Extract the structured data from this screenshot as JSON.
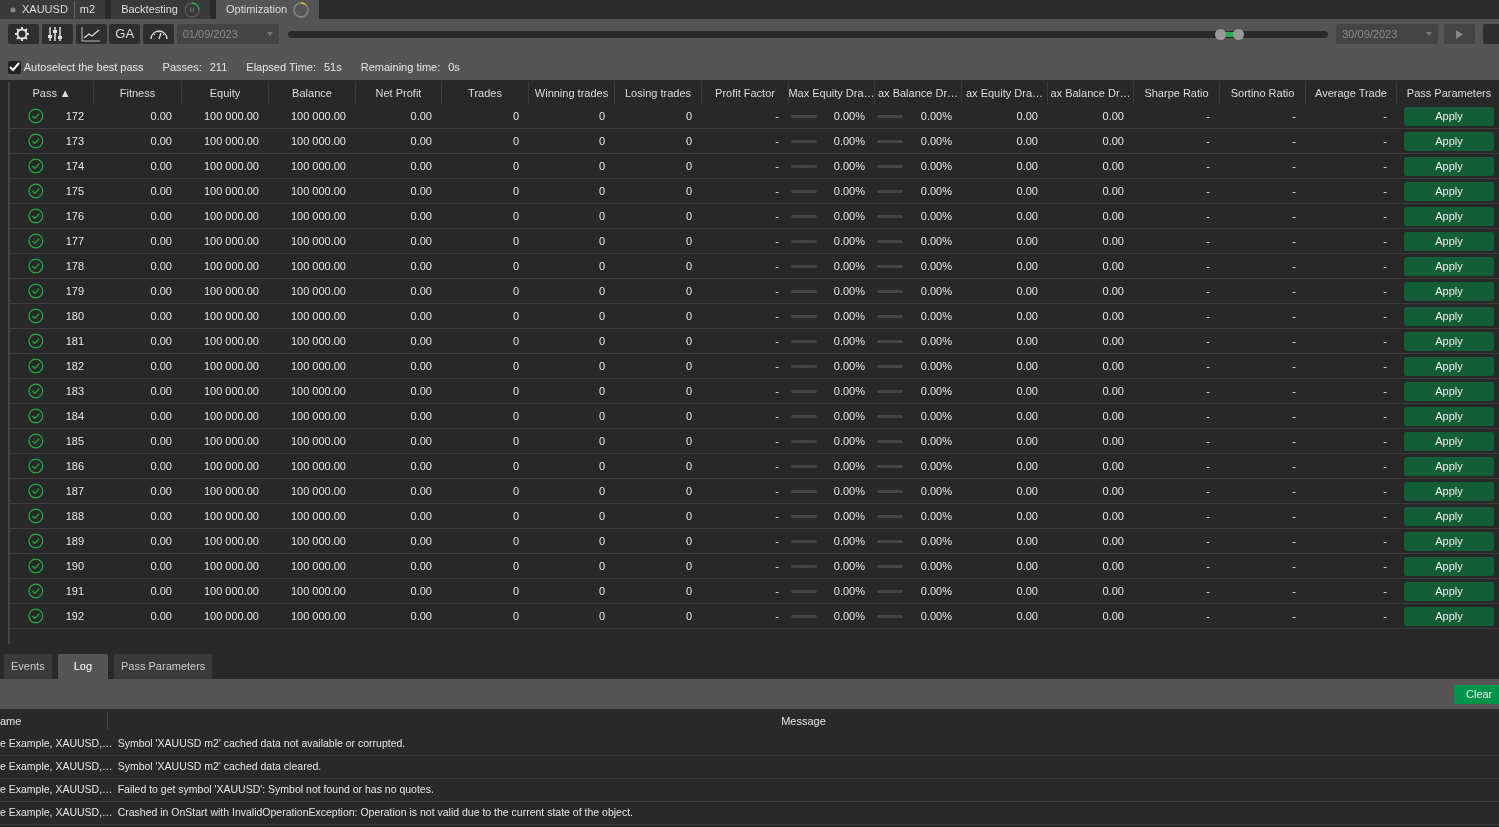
{
  "top_tabs": [
    {
      "kind": "symbol",
      "label": "XAUUSD",
      "sub": "m2",
      "selected": false
    },
    {
      "kind": "paused",
      "label": "Backtesting",
      "selected": false
    },
    {
      "kind": "running",
      "label": "Optimization",
      "selected": true
    }
  ],
  "toolbar": {
    "buttons": [
      {
        "kind": "gear"
      },
      {
        "kind": "sliders"
      },
      {
        "kind": "chart"
      },
      {
        "kind": "text",
        "label": "GA"
      },
      {
        "kind": "gauge"
      }
    ],
    "start_date": "01/09/2023",
    "end_date": "30/09/2023",
    "range": {
      "thumbs": [
        {
          "level": 0.897
        },
        {
          "level": 0.914
        }
      ]
    }
  },
  "status": {
    "autoselect": {
      "label": "Autoselect the best pass",
      "checked": true
    },
    "stats": [
      {
        "label": "Passes:",
        "value": "211"
      },
      {
        "label": "Elapsed Time:",
        "value": "51s"
      },
      {
        "label": "Remaining time:",
        "value": "0s"
      }
    ]
  },
  "table": {
    "columns": [
      "Pass",
      "Fitness",
      "Equity",
      "Balance",
      "Net Profit",
      "Trades",
      "Winning trades",
      "Losing trades",
      "Profit Factor",
      "Max Equity Dra…",
      "ax Balance Dr…",
      "ax Equity Dra…",
      "ax Balance Dr…",
      "Sharpe Ratio",
      "Sortino Ratio",
      "Average Trade",
      "Pass Parameters"
    ],
    "sort_indicator": "▲",
    "rows": [
      {
        "cells": [
          "172",
          "0.00",
          "100 000.00",
          "100 000.00",
          "0.00",
          "0",
          "0",
          "0",
          "-",
          "0.00%",
          "0.00%",
          "0.00",
          "0.00",
          "-",
          "-",
          "-",
          "Apply"
        ],
        "bars": [
          {
            "level": 0
          },
          {
            "level": 0
          }
        ]
      },
      {
        "cells": [
          "173",
          "0.00",
          "100 000.00",
          "100 000.00",
          "0.00",
          "0",
          "0",
          "0",
          "-",
          "0.00%",
          "0.00%",
          "0.00",
          "0.00",
          "-",
          "-",
          "-",
          "Apply"
        ],
        "bars": [
          {
            "level": 0
          },
          {
            "level": 0
          }
        ]
      },
      {
        "cells": [
          "174",
          "0.00",
          "100 000.00",
          "100 000.00",
          "0.00",
          "0",
          "0",
          "0",
          "-",
          "0.00%",
          "0.00%",
          "0.00",
          "0.00",
          "-",
          "-",
          "-",
          "Apply"
        ],
        "bars": [
          {
            "level": 0
          },
          {
            "level": 0
          }
        ]
      },
      {
        "cells": [
          "175",
          "0.00",
          "100 000.00",
          "100 000.00",
          "0.00",
          "0",
          "0",
          "0",
          "-",
          "0.00%",
          "0.00%",
          "0.00",
          "0.00",
          "-",
          "-",
          "-",
          "Apply"
        ],
        "bars": [
          {
            "level": 0
          },
          {
            "level": 0
          }
        ]
      },
      {
        "cells": [
          "176",
          "0.00",
          "100 000.00",
          "100 000.00",
          "0.00",
          "0",
          "0",
          "0",
          "-",
          "0.00%",
          "0.00%",
          "0.00",
          "0.00",
          "-",
          "-",
          "-",
          "Apply"
        ],
        "bars": [
          {
            "level": 0
          },
          {
            "level": 0
          }
        ]
      },
      {
        "cells": [
          "177",
          "0.00",
          "100 000.00",
          "100 000.00",
          "0.00",
          "0",
          "0",
          "0",
          "-",
          "0.00%",
          "0.00%",
          "0.00",
          "0.00",
          "-",
          "-",
          "-",
          "Apply"
        ],
        "bars": [
          {
            "level": 0
          },
          {
            "level": 0
          }
        ]
      },
      {
        "cells": [
          "178",
          "0.00",
          "100 000.00",
          "100 000.00",
          "0.00",
          "0",
          "0",
          "0",
          "-",
          "0.00%",
          "0.00%",
          "0.00",
          "0.00",
          "-",
          "-",
          "-",
          "Apply"
        ],
        "bars": [
          {
            "level": 0
          },
          {
            "level": 0
          }
        ]
      },
      {
        "cells": [
          "179",
          "0.00",
          "100 000.00",
          "100 000.00",
          "0.00",
          "0",
          "0",
          "0",
          "-",
          "0.00%",
          "0.00%",
          "0.00",
          "0.00",
          "-",
          "-",
          "-",
          "Apply"
        ],
        "bars": [
          {
            "level": 0
          },
          {
            "level": 0
          }
        ]
      },
      {
        "cells": [
          "180",
          "0.00",
          "100 000.00",
          "100 000.00",
          "0.00",
          "0",
          "0",
          "0",
          "-",
          "0.00%",
          "0.00%",
          "0.00",
          "0.00",
          "-",
          "-",
          "-",
          "Apply"
        ],
        "bars": [
          {
            "level": 0
          },
          {
            "level": 0
          }
        ]
      },
      {
        "cells": [
          "181",
          "0.00",
          "100 000.00",
          "100 000.00",
          "0.00",
          "0",
          "0",
          "0",
          "-",
          "0.00%",
          "0.00%",
          "0.00",
          "0.00",
          "-",
          "-",
          "-",
          "Apply"
        ],
        "bars": [
          {
            "level": 0
          },
          {
            "level": 0
          }
        ]
      },
      {
        "cells": [
          "182",
          "0.00",
          "100 000.00",
          "100 000.00",
          "0.00",
          "0",
          "0",
          "0",
          "-",
          "0.00%",
          "0.00%",
          "0.00",
          "0.00",
          "-",
          "-",
          "-",
          "Apply"
        ],
        "bars": [
          {
            "level": 0
          },
          {
            "level": 0
          }
        ]
      },
      {
        "cells": [
          "183",
          "0.00",
          "100 000.00",
          "100 000.00",
          "0.00",
          "0",
          "0",
          "0",
          "-",
          "0.00%",
          "0.00%",
          "0.00",
          "0.00",
          "-",
          "-",
          "-",
          "Apply"
        ],
        "bars": [
          {
            "level": 0
          },
          {
            "level": 0
          }
        ]
      },
      {
        "cells": [
          "184",
          "0.00",
          "100 000.00",
          "100 000.00",
          "0.00",
          "0",
          "0",
          "0",
          "-",
          "0.00%",
          "0.00%",
          "0.00",
          "0.00",
          "-",
          "-",
          "-",
          "Apply"
        ],
        "bars": [
          {
            "level": 0
          },
          {
            "level": 0
          }
        ]
      },
      {
        "cells": [
          "185",
          "0.00",
          "100 000.00",
          "100 000.00",
          "0.00",
          "0",
          "0",
          "0",
          "-",
          "0.00%",
          "0.00%",
          "0.00",
          "0.00",
          "-",
          "-",
          "-",
          "Apply"
        ],
        "bars": [
          {
            "level": 0
          },
          {
            "level": 0
          }
        ]
      },
      {
        "cells": [
          "186",
          "0.00",
          "100 000.00",
          "100 000.00",
          "0.00",
          "0",
          "0",
          "0",
          "-",
          "0.00%",
          "0.00%",
          "0.00",
          "0.00",
          "-",
          "-",
          "-",
          "Apply"
        ],
        "bars": [
          {
            "level": 0
          },
          {
            "level": 0
          }
        ]
      },
      {
        "cells": [
          "187",
          "0.00",
          "100 000.00",
          "100 000.00",
          "0.00",
          "0",
          "0",
          "0",
          "-",
          "0.00%",
          "0.00%",
          "0.00",
          "0.00",
          "-",
          "-",
          "-",
          "Apply"
        ],
        "bars": [
          {
            "level": 0
          },
          {
            "level": 0
          }
        ]
      },
      {
        "cells": [
          "188",
          "0.00",
          "100 000.00",
          "100 000.00",
          "0.00",
          "0",
          "0",
          "0",
          "-",
          "0.00%",
          "0.00%",
          "0.00",
          "0.00",
          "-",
          "-",
          "-",
          "Apply"
        ],
        "bars": [
          {
            "level": 0
          },
          {
            "level": 0
          }
        ]
      },
      {
        "cells": [
          "189",
          "0.00",
          "100 000.00",
          "100 000.00",
          "0.00",
          "0",
          "0",
          "0",
          "-",
          "0.00%",
          "0.00%",
          "0.00",
          "0.00",
          "-",
          "-",
          "-",
          "Apply"
        ],
        "bars": [
          {
            "level": 0
          },
          {
            "level": 0
          }
        ]
      },
      {
        "cells": [
          "190",
          "0.00",
          "100 000.00",
          "100 000.00",
          "0.00",
          "0",
          "0",
          "0",
          "-",
          "0.00%",
          "0.00%",
          "0.00",
          "0.00",
          "-",
          "-",
          "-",
          "Apply"
        ],
        "bars": [
          {
            "level": 0
          },
          {
            "level": 0
          }
        ]
      },
      {
        "cells": [
          "191",
          "0.00",
          "100 000.00",
          "100 000.00",
          "0.00",
          "0",
          "0",
          "0",
          "-",
          "0.00%",
          "0.00%",
          "0.00",
          "0.00",
          "-",
          "-",
          "-",
          "Apply"
        ],
        "bars": [
          {
            "level": 0
          },
          {
            "level": 0
          }
        ]
      },
      {
        "cells": [
          "192",
          "0.00",
          "100 000.00",
          "100 000.00",
          "0.00",
          "0",
          "0",
          "0",
          "-",
          "0.00%",
          "0.00%",
          "0.00",
          "0.00",
          "-",
          "-",
          "-",
          "Apply"
        ],
        "bars": [
          {
            "level": 0
          },
          {
            "level": 0
          }
        ]
      }
    ]
  },
  "bottom_tabs": [
    {
      "label": "Events",
      "selected": false
    },
    {
      "label": "Log",
      "selected": true
    },
    {
      "label": "Pass Parameters",
      "selected": false
    }
  ],
  "log": {
    "clear_button": "Clear",
    "columns": [
      "ame",
      "Message"
    ],
    "rows": [
      {
        "name": "e Example, XAUUSD,…",
        "message": "Symbol 'XAUUSD m2' cached data not available or corrupted."
      },
      {
        "name": "e Example, XAUUSD,…",
        "message": "Symbol 'XAUUSD m2' cached data cleared."
      },
      {
        "name": "e Example, XAUUSD,…",
        "message": "Failed to get symbol 'XAUUSD': Symbol not found or has no quotes."
      },
      {
        "name": "e Example, XAUUSD,…",
        "message": "Crashed in OnStart with InvalidOperationException: Operation is not valid due to the current state of the object."
      }
    ]
  }
}
